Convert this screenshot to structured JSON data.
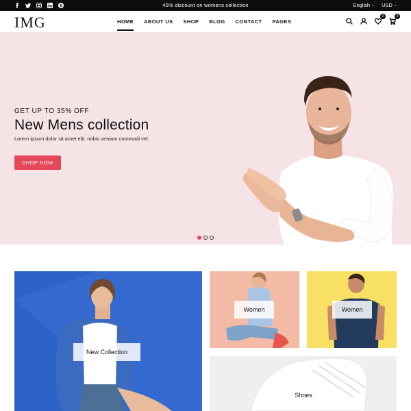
{
  "topbar": {
    "social": [
      "facebook-icon",
      "twitter-icon",
      "instagram-icon",
      "linkedin-icon",
      "pinterest-icon"
    ],
    "promo": "40% discount on womens collection",
    "language": "English",
    "currency": "USD"
  },
  "header": {
    "logo": "IMG",
    "nav": [
      "HOME",
      "ABOUT US",
      "SHOP",
      "BLOG",
      "CONTACT",
      "PAGES"
    ],
    "wishlist_count": "0",
    "cart_count": "0"
  },
  "hero": {
    "subtitle": "GET UP TO 35% OFF",
    "title": "New Mens collection",
    "description": "Lorem ipsum dolor sit amet elit. nobis veniam commodi vel.",
    "button": "SHOP NOW",
    "slides": 3,
    "active_slide": 1
  },
  "categories": [
    {
      "label": "New Collection"
    },
    {
      "label": "Women"
    },
    {
      "label": "Women"
    },
    {
      "label": "Shoes"
    }
  ],
  "colors": {
    "accent": "#e5485b",
    "hero_bg": "#f5e3e5",
    "topbar_bg": "#0d0d0d"
  }
}
